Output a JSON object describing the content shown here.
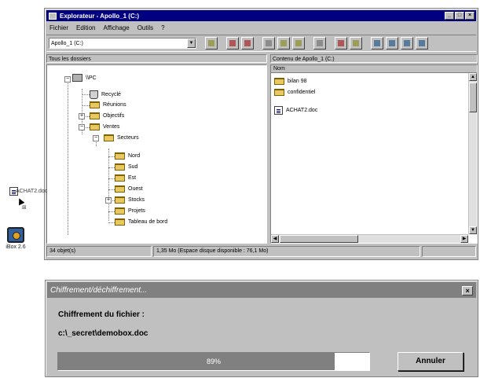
{
  "explorer": {
    "title": "Explorateur - Apollo_1 (C:)",
    "menu": [
      "Fichier",
      "Edition",
      "Affichage",
      "Outils",
      "?"
    ],
    "drive_combo": "Apollo_1 (C:)",
    "left_header": "Tous les dossiers",
    "right_header": "Contenu de Apollo_1 (C:)",
    "column_name": "Nom",
    "tree": {
      "root": "\\\\PC",
      "items": {
        "recycle": "Recyclé",
        "reunions": "Réunions",
        "objectifs": "Objectifs",
        "ventes": "Ventes",
        "secteurs": "Secteurs",
        "nord": "Nord",
        "sud": "Sud",
        "est": "Est",
        "ouest": "Ouest",
        "stocks": "Stocks",
        "projets": "Projets",
        "tableau": "Tableau de bord"
      }
    },
    "files": [
      "bilan 98",
      "confidentiel",
      "ACHAT2.doc"
    ],
    "status": {
      "objects": "34 objet(s)",
      "space": "1,35 Mo (Espace disque disponible : 76,1 Mo)"
    }
  },
  "drag": {
    "label": "ACHAT2.doc"
  },
  "desktop_icon": {
    "label": "iBox 2.6"
  },
  "dialog": {
    "title": "Chiffrement/déchiffrement...",
    "line1": "Chiffrement du fichier :",
    "line2": "c:\\_secret\\demobox.doc",
    "progress_label": "89%",
    "progress_value": 0.89,
    "cancel": "Annuler"
  }
}
